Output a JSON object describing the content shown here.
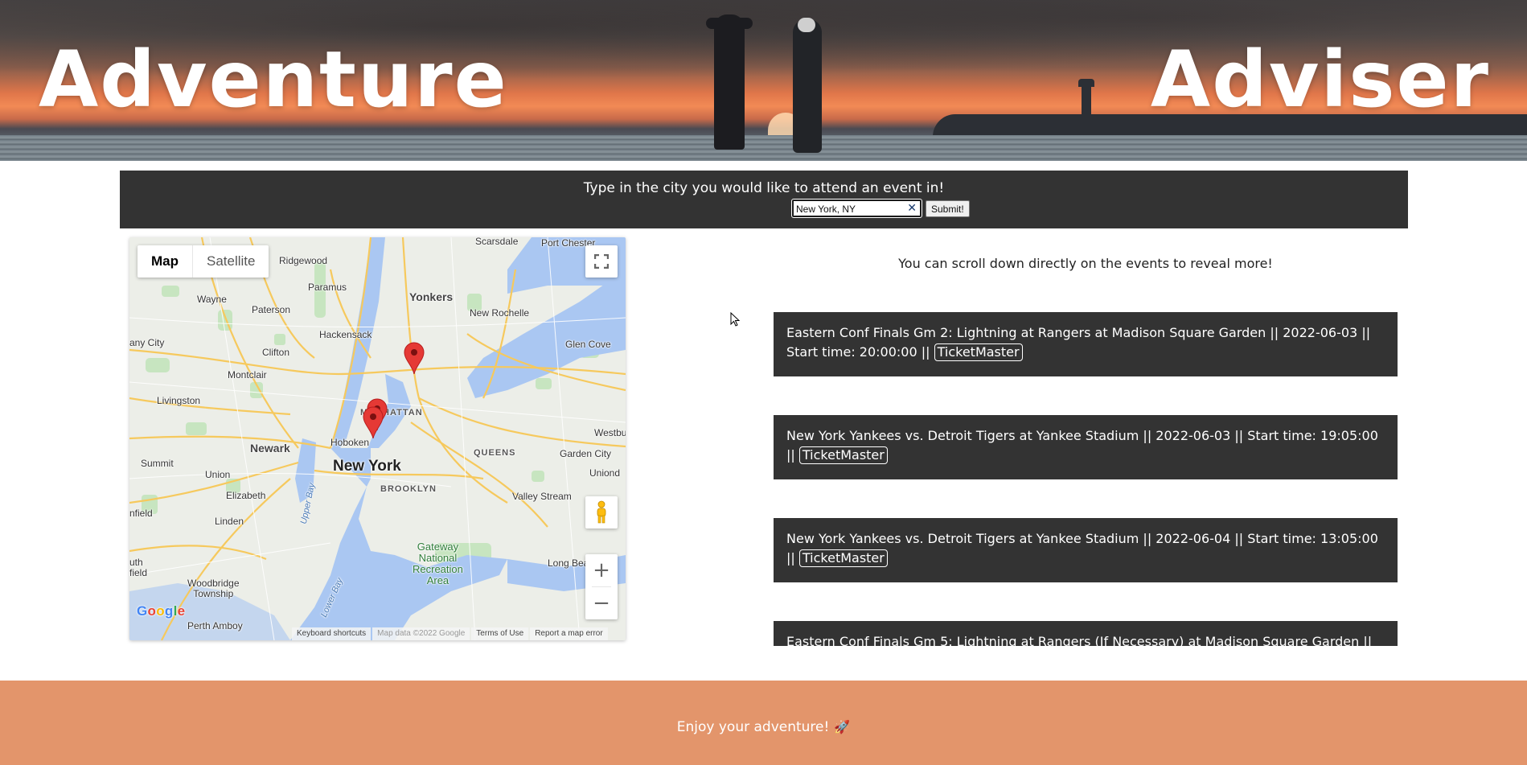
{
  "header": {
    "title_left": "Adventure",
    "title_right": "Adviser"
  },
  "search": {
    "prompt": "Type in the city you would like to attend an event in!",
    "value": "New York, NY",
    "submit_label": "Submit!",
    "clear_icon": "close-icon"
  },
  "map": {
    "type_options": [
      "Map",
      "Satellite"
    ],
    "active_type": "Map",
    "logo": "Google",
    "footer": {
      "shortcuts": "Keyboard shortcuts",
      "data": "Map data ©2022 Google",
      "terms": "Terms of Use",
      "report": "Report a map error"
    },
    "labels": {
      "scarsdale": "Scarsdale",
      "port_chester": "Port Chester",
      "ridgewood": "Ridgewood",
      "paramus": "Paramus",
      "wayne": "Wayne",
      "paterson": "Paterson",
      "yonkers": "Yonkers",
      "new_rochelle": "New Rochelle",
      "hackensack": "Hackensack",
      "glen_cove": "Glen Cove",
      "any_city": "any City",
      "clifton": "Clifton",
      "montclair": "Montclair",
      "livingston": "Livingston",
      "manhattan": "MANHATTAN",
      "hoboken": "Hoboken",
      "westbury": "Westbu",
      "newark": "Newark",
      "queens": "QUEENS",
      "garden_city": "Garden City",
      "summit": "Summit",
      "union": "Union",
      "new_york": "New York",
      "uniondale": "Uniond",
      "brooklyn": "BROOKLYN",
      "elizabeth": "Elizabeth",
      "valley_stream": "Valley Stream",
      "field": "nfield",
      "linden": "Linden",
      "upper_bay": "Upper Bay",
      "gateway": "Gateway\nNational\nRecreation\nArea",
      "long_beach": "Long Bea",
      "south_field": "uth\nfield",
      "woodbridge": "Woodbridge\nTownship",
      "lower_bay": "Lower Bay",
      "perth_amboy": "Perth Amboy"
    },
    "markers": 3
  },
  "events": {
    "hint": "You can scroll down directly on the events to reveal more!",
    "items": [
      {
        "text": "Eastern Conf Finals Gm 2: Lightning at Rangers at Madison Square Garden || 2022-06-03 || Start time: 20:00:00 || ",
        "link": "TicketMaster"
      },
      {
        "text": "New York Yankees vs. Detroit Tigers at Yankee Stadium || 2022-06-03 || Start time: 19:05:00 || ",
        "link": "TicketMaster"
      },
      {
        "text": "New York Yankees vs. Detroit Tigers at Yankee Stadium || 2022-06-04 || Start time: 13:05:00 || ",
        "link": "TicketMaster"
      },
      {
        "text": "Eastern Conf Finals Gm 5: Lightning at Rangers (If Necessary) at Madison Square Garden || ",
        "link": ""
      }
    ]
  },
  "footer": {
    "text": "Enjoy your adventure!",
    "icon": "rocket-icon"
  },
  "colors": {
    "search_bg": "#333333",
    "event_bg": "#333333",
    "footer_bg": "#e3956b",
    "marker": "#e53935"
  }
}
